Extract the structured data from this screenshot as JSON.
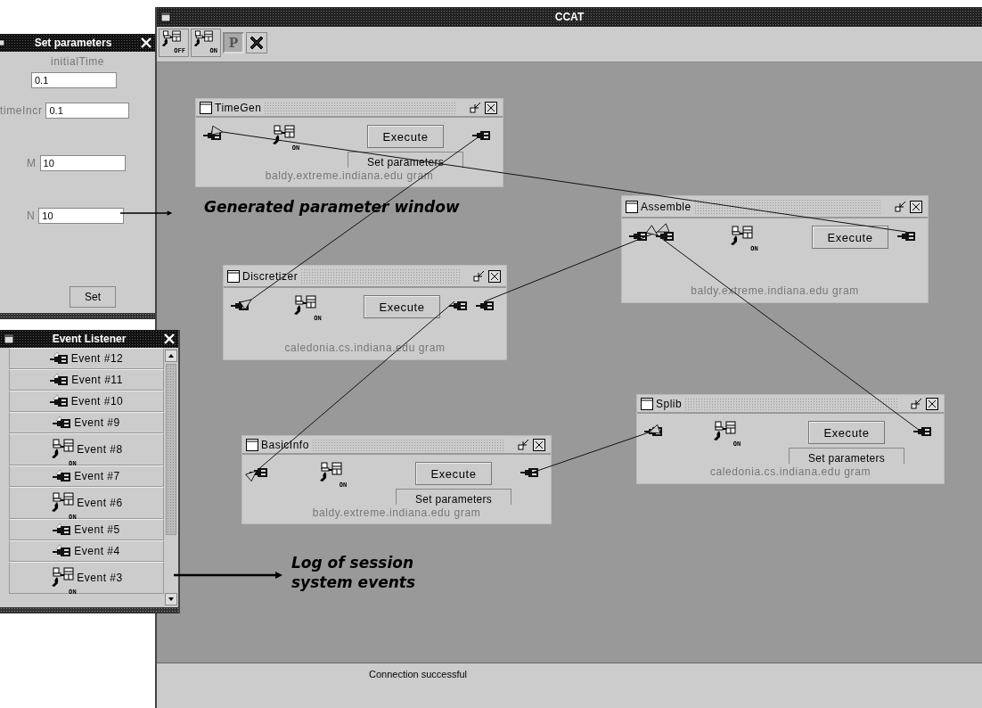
{
  "main_window": {
    "title": "CCAT",
    "toolbar": [
      {
        "kind": "status",
        "badge": "OFF"
      },
      {
        "kind": "status",
        "badge": "ON"
      },
      {
        "kind": "text",
        "label": "P"
      },
      {
        "kind": "close"
      }
    ],
    "components": [
      {
        "title": "TimeGen",
        "ports": [
          {
            "kind": "in"
          },
          {
            "kind": "out"
          }
        ],
        "badge": "ON",
        "buttons": [
          "Execute",
          "Set parameters"
        ],
        "host": "baldy.extreme.indiana.edu gram"
      },
      {
        "title": "Discretizer",
        "ports": [
          {
            "kind": "in"
          },
          {
            "kind": "out"
          },
          {
            "kind": "out"
          }
        ],
        "badge": "ON",
        "buttons": [
          "Execute"
        ],
        "host": "caledonia.cs.indiana.edu gram"
      },
      {
        "title": "Assemble",
        "ports": [
          {
            "kind": "in"
          },
          {
            "kind": "in"
          },
          {
            "kind": "out"
          }
        ],
        "badge": "ON",
        "buttons": [
          "Execute"
        ],
        "host": "baldy.extreme.indiana.edu gram"
      },
      {
        "title": "BasicInfo",
        "ports": [
          {
            "kind": "in"
          },
          {
            "kind": "out"
          }
        ],
        "badge": "ON",
        "buttons": [
          "Execute",
          "Set parameters"
        ],
        "host": "baldy.extreme.indiana.edu gram"
      },
      {
        "title": "Splib",
        "ports": [
          {
            "kind": "in"
          },
          {
            "kind": "out"
          }
        ],
        "badge": "ON",
        "buttons": [
          "Execute",
          "Set parameters"
        ],
        "host": "caledonia.cs.indiana.edu gram"
      }
    ],
    "status_bar": "Connection successful"
  },
  "parameter_window": {
    "title": "Set parameters",
    "fields": [
      {
        "kind": "stacked",
        "label": "initialTime",
        "value": "0.1"
      },
      {
        "kind": "inline",
        "label": "timeIncr",
        "value": "0.1"
      },
      {
        "kind": "inline",
        "label": "M",
        "value": "10"
      },
      {
        "kind": "inline",
        "label": "N",
        "value": "10"
      }
    ],
    "button": "Set"
  },
  "event_window": {
    "title": "Event Listener",
    "events": [
      {
        "kind": "plug",
        "label": "Event #12"
      },
      {
        "kind": "plug",
        "label": "Event #11"
      },
      {
        "kind": "plug",
        "label": "Event #10"
      },
      {
        "kind": "plug",
        "label": "Event #9"
      },
      {
        "kind": "status",
        "badge": "ON",
        "label": "Event #8"
      },
      {
        "kind": "plug",
        "label": "Event #7"
      },
      {
        "kind": "status",
        "badge": "ON",
        "label": "Event #6"
      },
      {
        "kind": "plug",
        "label": "Event #5"
      },
      {
        "kind": "plug",
        "label": "Event #4"
      },
      {
        "kind": "status",
        "badge": "ON",
        "label": "Event #3"
      }
    ]
  },
  "annotations": [
    "Generated parameter window",
    "Log of session system events"
  ]
}
